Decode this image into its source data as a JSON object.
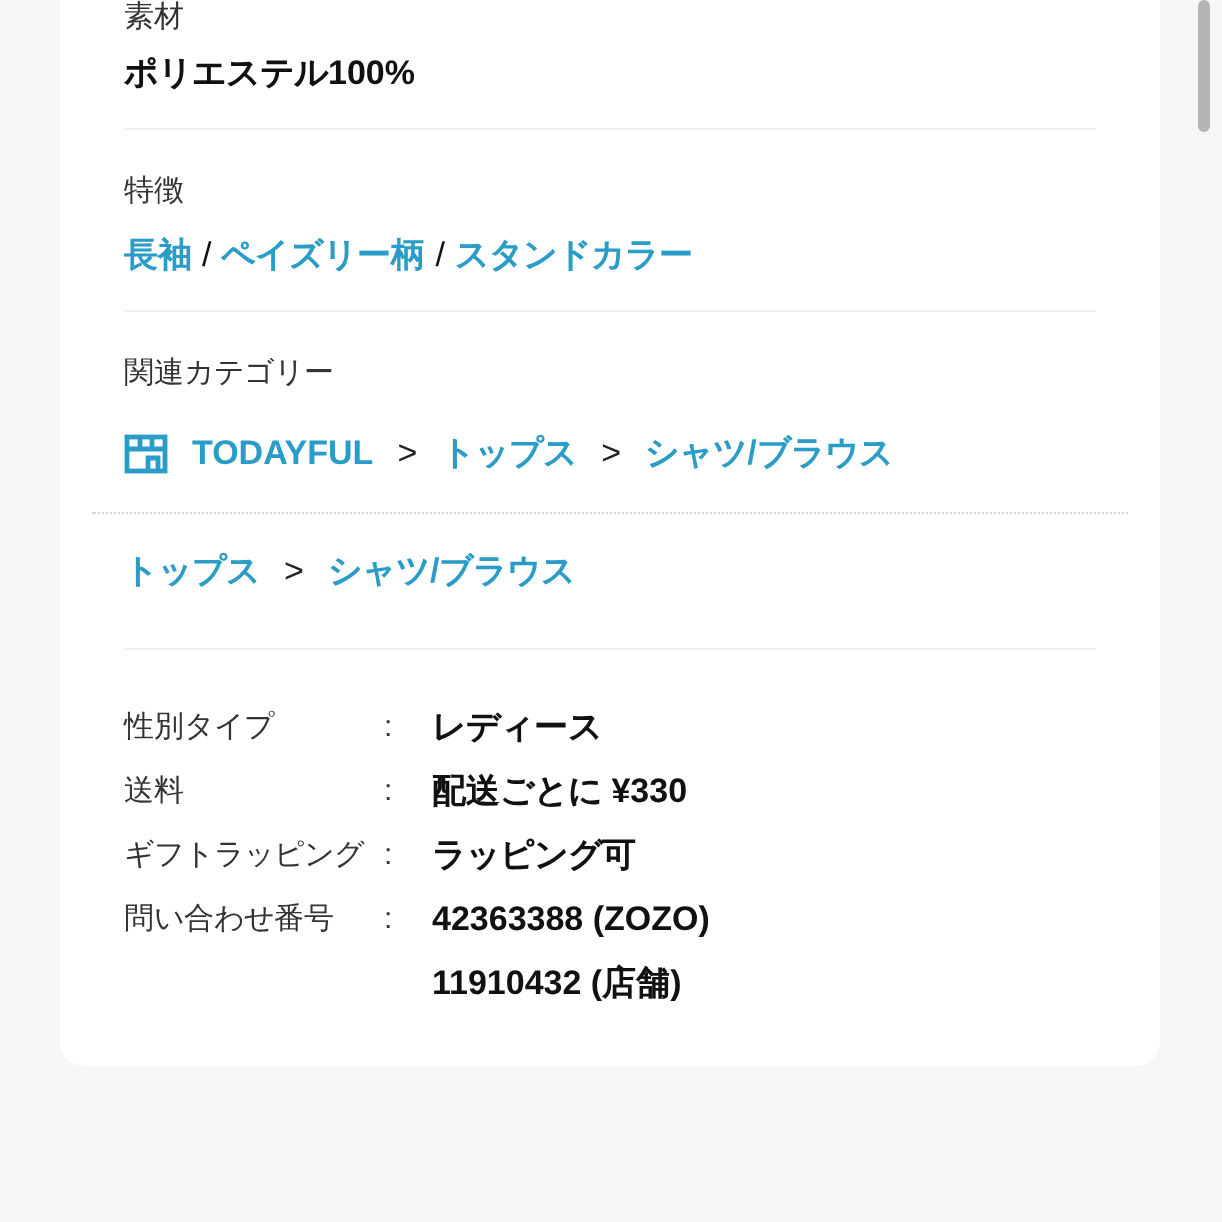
{
  "material": {
    "label": "素材",
    "value": "ポリエステル100%"
  },
  "features": {
    "label": "特徴",
    "items": [
      {
        "label": "長袖",
        "separator": "/"
      },
      {
        "label": "ペイズリー柄",
        "separator": "/"
      },
      {
        "label": "スタンドカラー"
      }
    ]
  },
  "categories": {
    "label": "関連カテゴリー",
    "paths": [
      {
        "kind": "shop",
        "items": [
          {
            "label": "TODAYFUL",
            "separator": ">"
          },
          {
            "label": "トップス",
            "separator": ">"
          },
          {
            "label": "シャツ/ブラウス"
          }
        ]
      },
      {
        "kind": "plain",
        "items": [
          {
            "label": "トップス",
            "separator": ">"
          },
          {
            "label": "シャツ/ブラウス"
          }
        ]
      }
    ]
  },
  "specs": [
    {
      "label": "性別タイプ",
      "colon": ":",
      "values": [
        "レディース"
      ]
    },
    {
      "label": "送料",
      "colon": ":",
      "values": [
        "配送ごとに ¥330"
      ]
    },
    {
      "label": "ギフトラッピング",
      "colon": ":",
      "values": [
        "ラッピング可"
      ]
    },
    {
      "label": "問い合わせ番号",
      "colon": ":",
      "values": [
        "42363388 (ZOZO)",
        "11910432 (店舗)"
      ]
    }
  ]
}
